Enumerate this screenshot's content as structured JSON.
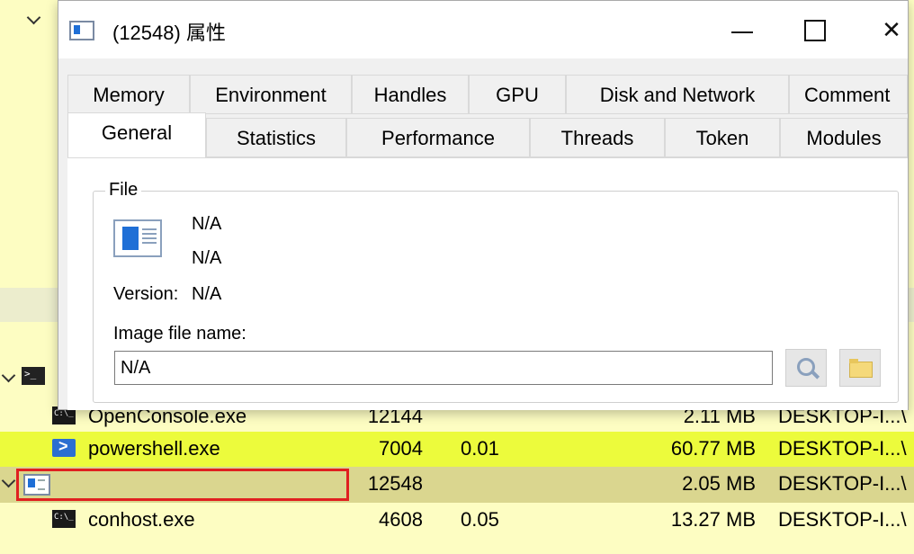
{
  "dialog": {
    "title": "(12548) 属性",
    "close_glyph": "✕",
    "tabs_row1": [
      "Memory",
      "Environment",
      "Handles",
      "GPU",
      "Disk and Network",
      "Comment"
    ],
    "tabs_row2": [
      "General",
      "Statistics",
      "Performance",
      "Threads",
      "Token",
      "Modules"
    ],
    "active_tab": "General",
    "file_group": {
      "legend": "File",
      "description": "N/A",
      "company": "N/A",
      "version_label": "Version:",
      "version_value": "N/A",
      "image_file_label": "Image file name:",
      "image_file_value": "N/A"
    }
  },
  "process_list": {
    "rows": [
      {
        "name": "OpenConsole.exe",
        "pid": "12144",
        "cpu": "",
        "memory": "2.11 MB",
        "user": "DESKTOP-I...\\",
        "icon": "cmd-icon"
      },
      {
        "name": "powershell.exe",
        "pid": "7004",
        "cpu": "0.01",
        "memory": "60.77 MB",
        "user": "DESKTOP-I...\\",
        "icon": "powershell-icon"
      },
      {
        "name": "",
        "pid": "12548",
        "cpu": "",
        "memory": "2.05 MB",
        "user": "DESKTOP-I...\\",
        "icon": "window-icon"
      },
      {
        "name": "conhost.exe",
        "pid": "4608",
        "cpu": "0.05",
        "memory": "13.27 MB",
        "user": "DESKTOP-I...\\",
        "icon": "cmd-icon"
      }
    ]
  },
  "colors": {
    "row_background": "#fdfdc2",
    "row_highlight_powershell": "#ecfb3c",
    "row_selected": "#dad68f",
    "selection_box": "#e02020"
  }
}
